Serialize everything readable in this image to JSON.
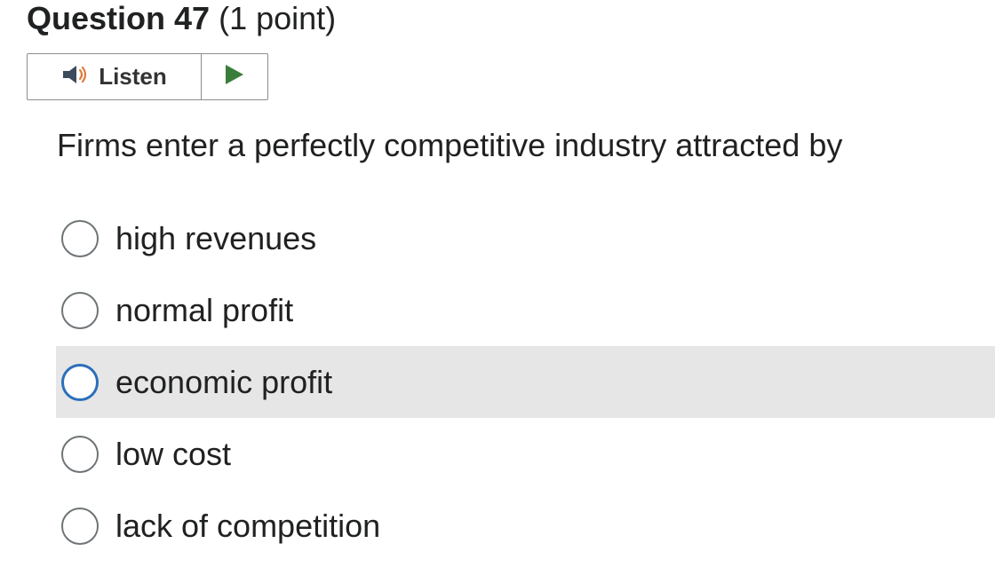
{
  "question": {
    "title": "Question 47",
    "points": "(1 point)",
    "text": "Firms enter a perfectly competitive industry attracted by"
  },
  "listen": {
    "label": "Listen",
    "speaker_icon": "speaker-icon",
    "play_icon": "play-icon",
    "play_color": "#3a7d3a",
    "speaker_color": "#3d4a5c",
    "wave_color": "#e07b39"
  },
  "options": [
    {
      "label": "high revenues"
    },
    {
      "label": "normal profit"
    },
    {
      "label": "economic profit",
      "hovered": true
    },
    {
      "label": "low cost"
    },
    {
      "label": "lack of competition"
    }
  ],
  "colors": {
    "hover_background": "#e6e6e6",
    "focus_radio_border": "#2c6fbb"
  }
}
